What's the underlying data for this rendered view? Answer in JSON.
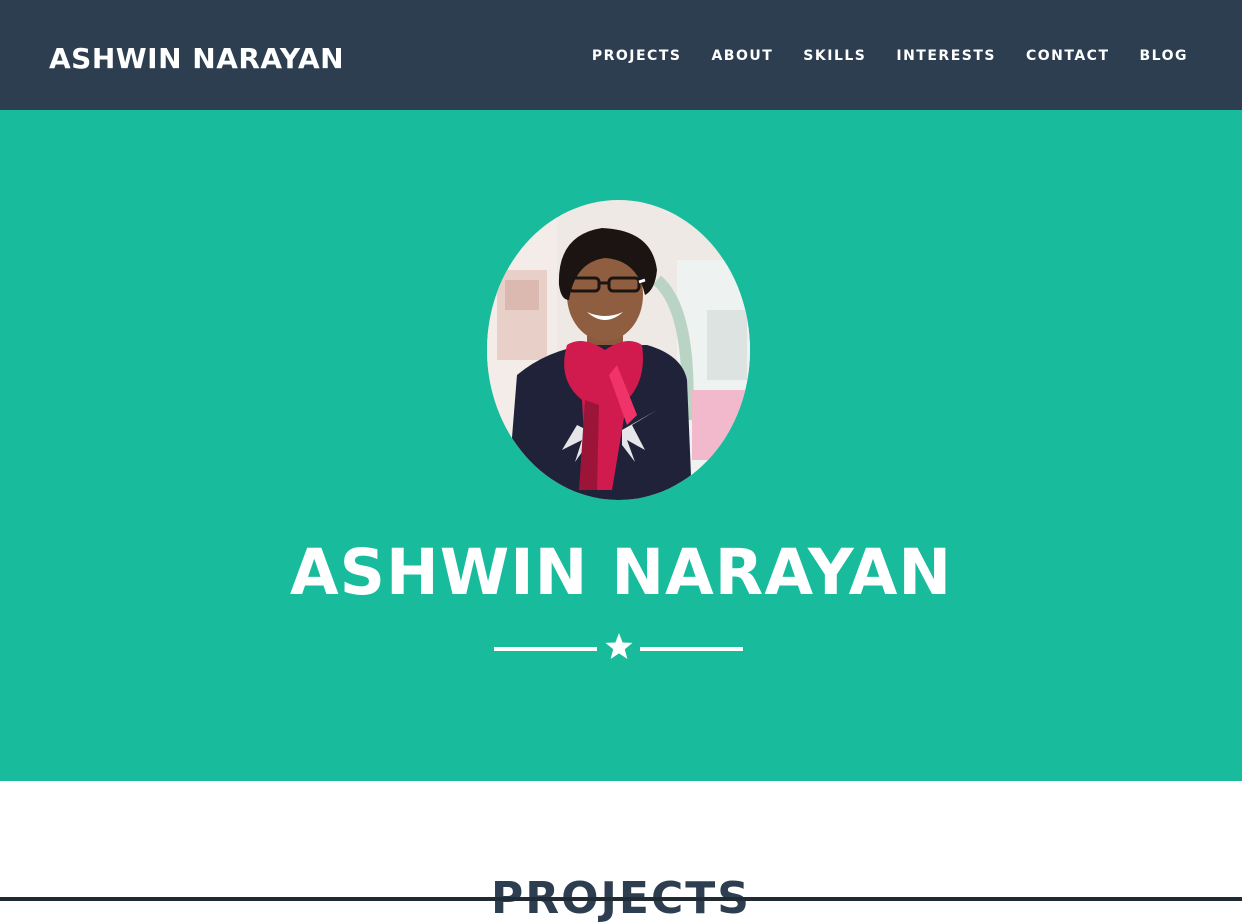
{
  "navbar": {
    "brand": "ASHWIN NARAYAN",
    "links": [
      {
        "label": "PROJECTS"
      },
      {
        "label": "ABOUT"
      },
      {
        "label": "SKILLS"
      },
      {
        "label": "INTERESTS"
      },
      {
        "label": "CONTACT"
      },
      {
        "label": "BLOG"
      }
    ]
  },
  "hero": {
    "name": "ASHWIN NARAYAN",
    "divider_icon": "star-icon"
  },
  "sections": {
    "projects_heading": "PROJECTS"
  },
  "colors": {
    "navbar_bg": "#2c3e50",
    "hero_bg": "#18bc9c",
    "text_light": "#ffffff",
    "heading_dark": "#2c3e50"
  }
}
